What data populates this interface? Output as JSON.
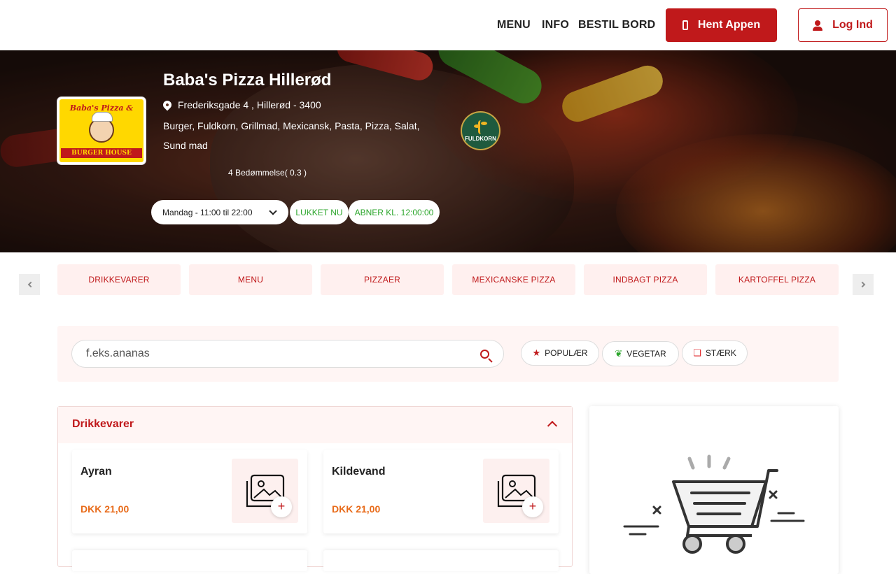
{
  "header": {
    "nav": [
      "MENU",
      "INFO",
      "BESTIL BORD"
    ],
    "app_button": "Hent Appen",
    "login_button": "Log Ind"
  },
  "restaurant": {
    "logo_text": "Baba's Pizza & Grill",
    "logo_band": "BURGER HOUSE",
    "name": "Baba's Pizza Hillerød",
    "address": "Frederiksgade 4 , Hillerød - 3400",
    "cuisines": "Burger, Fuldkorn, Grillmad, Mexicansk, Pasta, Pizza, Salat, Sund mad",
    "rating_text": "4  Bedømmelse( 0.3 )",
    "badge_text": "FULDKORN",
    "hours_select": "Mandag - 11:00 til 22:00",
    "status": "LUKKET NU",
    "opens": "ABNER KL. 12:00:00"
  },
  "categories": [
    "DRIKKEVARER",
    "MENU",
    "PIZZAER",
    "MEXICANSKE PIZZA",
    "INDBAGT PIZZA",
    "KARTOFFEL PIZZA"
  ],
  "search": {
    "placeholder": "f.eks.ananas"
  },
  "filters": [
    {
      "label": "POPULÆR",
      "icon": "star-icon"
    },
    {
      "label": "VEGETAR",
      "icon": "leaf-icon"
    },
    {
      "label": "STÆRK",
      "icon": "chili-icon"
    }
  ],
  "section": {
    "title": "Drikkevarer",
    "items": [
      {
        "name": "Ayran",
        "price": "DKK 21,00"
      },
      {
        "name": "Kildevand",
        "price": "DKK 21,00"
      }
    ]
  },
  "colors": {
    "brand": "#c0191b",
    "price": "#e86b1a",
    "open_green": "#2aa52a"
  }
}
